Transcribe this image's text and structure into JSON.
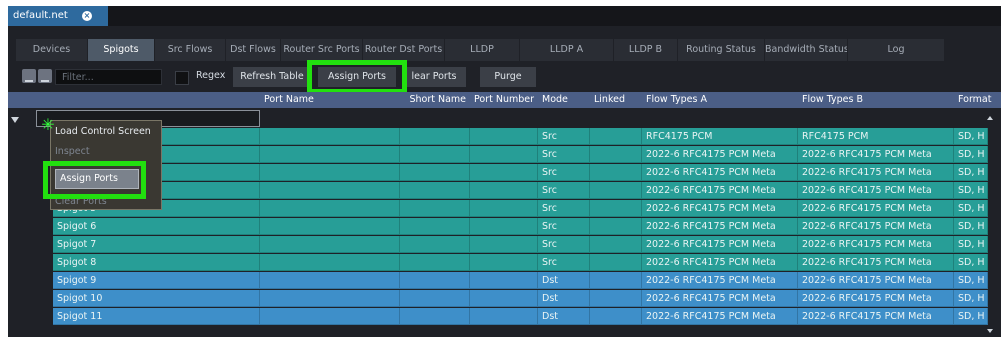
{
  "document_tab": {
    "label": "default.net",
    "close_icon": "close-icon"
  },
  "tabs": [
    {
      "label": "Devices",
      "active": false
    },
    {
      "label": "Spigots",
      "active": true
    },
    {
      "label": "Src Flows",
      "active": false
    },
    {
      "label": "Dst Flows",
      "active": false
    },
    {
      "label": "Router Src Ports",
      "active": false
    },
    {
      "label": "Router Dst Ports",
      "active": false
    },
    {
      "label": "LLDP",
      "active": false
    },
    {
      "label": "LLDP A",
      "active": false
    },
    {
      "label": "LLDP B",
      "active": false
    },
    {
      "label": "Routing Status",
      "active": false
    },
    {
      "label": "Bandwidth Status",
      "active": false
    },
    {
      "label": "Log",
      "active": false
    }
  ],
  "toolbar": {
    "filter_placeholder": "Filter...",
    "regex_label": "Regex",
    "refresh_label": "Refresh Table",
    "assign_label": "Assign Ports",
    "clear_label": "lear Ports",
    "purge_label": "Purge"
  },
  "columns": [
    "Port Name",
    "Short Name",
    "Port Number",
    "Mode",
    "Linked",
    "Flow Types A",
    "Flow Types B",
    "Format"
  ],
  "context_menu": {
    "items": [
      "Load Control Screen",
      "Inspect",
      "Assign Ports",
      "Clear Ports"
    ]
  },
  "rows": [
    {
      "name": "",
      "mode": "Src",
      "flow_a": "RFC4175  PCM",
      "flow_b": "RFC4175  PCM",
      "format": "SD, H",
      "type": "src"
    },
    {
      "name": "",
      "mode": "Src",
      "flow_a": "2022-6  RFC4175  PCM  Meta",
      "flow_b": "2022-6  RFC4175  PCM  Meta",
      "format": "SD, H",
      "type": "src"
    },
    {
      "name": "",
      "mode": "Src",
      "flow_a": "2022-6  RFC4175  PCM  Meta",
      "flow_b": "2022-6  RFC4175  PCM  Meta",
      "format": "SD, H",
      "type": "src"
    },
    {
      "name": "",
      "mode": "Src",
      "flow_a": "2022-6  RFC4175  PCM  Meta",
      "flow_b": "2022-6  RFC4175  PCM  Meta",
      "format": "SD, H",
      "type": "src"
    },
    {
      "name": "Spigot 5",
      "mode": "Src",
      "flow_a": "2022-6  RFC4175  PCM  Meta",
      "flow_b": "2022-6  RFC4175  PCM  Meta",
      "format": "SD, H",
      "type": "src"
    },
    {
      "name": "Spigot 6",
      "mode": "Src",
      "flow_a": "2022-6  RFC4175  PCM  Meta",
      "flow_b": "2022-6  RFC4175  PCM  Meta",
      "format": "SD, H",
      "type": "src"
    },
    {
      "name": "Spigot 7",
      "mode": "Src",
      "flow_a": "2022-6  RFC4175  PCM  Meta",
      "flow_b": "2022-6  RFC4175  PCM  Meta",
      "format": "SD, H",
      "type": "src"
    },
    {
      "name": "Spigot 8",
      "mode": "Src",
      "flow_a": "2022-6  RFC4175  PCM  Meta",
      "flow_b": "2022-6  RFC4175  PCM  Meta",
      "format": "SD, H",
      "type": "src"
    },
    {
      "name": "Spigot 9",
      "mode": "Dst",
      "flow_a": "2022-6  RFC4175  PCM  Meta",
      "flow_b": "2022-6  RFC4175  PCM  Meta",
      "format": "SD, H",
      "type": "dst"
    },
    {
      "name": "Spigot 10",
      "mode": "Dst",
      "flow_a": "2022-6  RFC4175  PCM  Meta",
      "flow_b": "2022-6  RFC4175  PCM  Meta",
      "format": "SD, H",
      "type": "dst"
    },
    {
      "name": "Spigot 11",
      "mode": "Dst",
      "flow_a": "2022-6  RFC4175  PCM  Meta",
      "flow_b": "2022-6  RFC4175  PCM  Meta",
      "format": "SD, H",
      "type": "dst"
    }
  ],
  "colors": {
    "highlight": "#22e00f",
    "src_row": "#279e97",
    "dst_row": "#3e8fc9",
    "header": "#4b5e86"
  }
}
